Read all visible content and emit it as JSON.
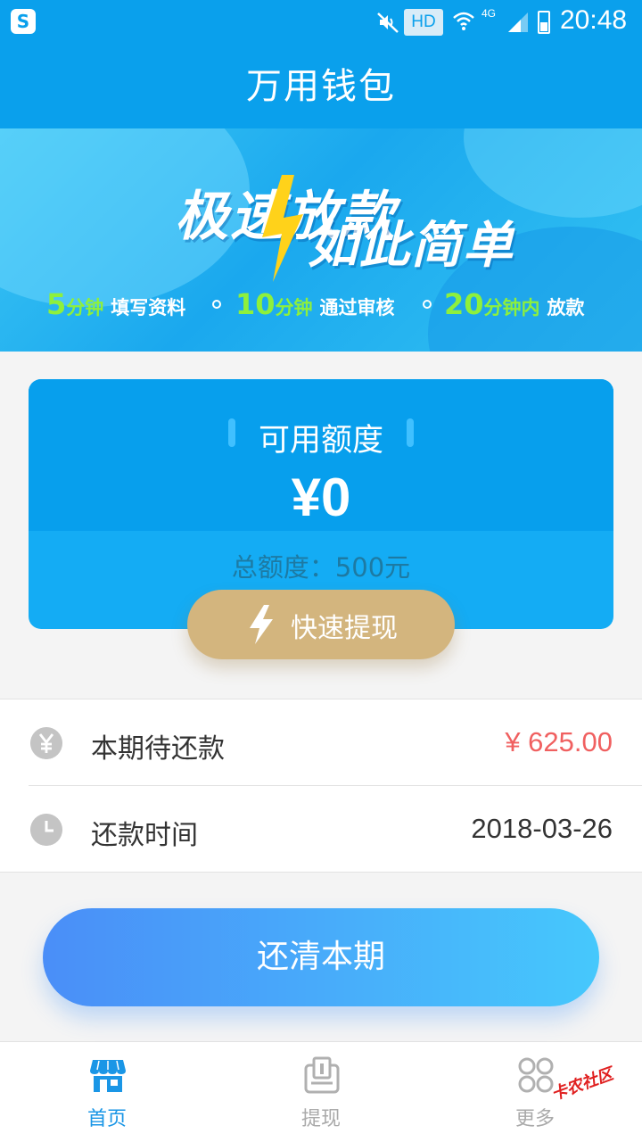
{
  "status_bar": {
    "network": "HD",
    "cell": "4G",
    "time": "20:48",
    "app_icon": "S"
  },
  "header": {
    "title": "万用钱包"
  },
  "banner": {
    "line1": "极速放款",
    "line2": "如此简单",
    "steps": [
      {
        "num": "5",
        "unit": "分钟",
        "text": "填写资料"
      },
      {
        "num": "10",
        "unit": "分钟",
        "text": "通过审核"
      },
      {
        "num": "20",
        "unit": "分钟内",
        "text": "放款"
      }
    ]
  },
  "credit_card": {
    "label": "可用额度",
    "amount": "¥0",
    "total": "总额度：500元"
  },
  "withdraw_button": {
    "label": "快速提现"
  },
  "repayment": {
    "due_label": "本期待还款",
    "due_value": "¥ 625.00",
    "date_label": "还款时间",
    "date_value": "2018-03-26"
  },
  "repay_button": {
    "label": "还清本期"
  },
  "bottom_nav": {
    "items": [
      {
        "label": "首页",
        "icon": "store-icon",
        "active": true
      },
      {
        "label": "提现",
        "icon": "withdraw-icon",
        "active": false
      },
      {
        "label": "更多",
        "icon": "more-icon",
        "active": false
      }
    ]
  },
  "watermark": {
    "text": "卡农社区"
  },
  "colors": {
    "primary": "#0aa0ec",
    "accent_gold": "#d3b57e",
    "due_red": "#f06060",
    "nav_active": "#1a96e6",
    "highlight_green": "#8ef03c"
  }
}
